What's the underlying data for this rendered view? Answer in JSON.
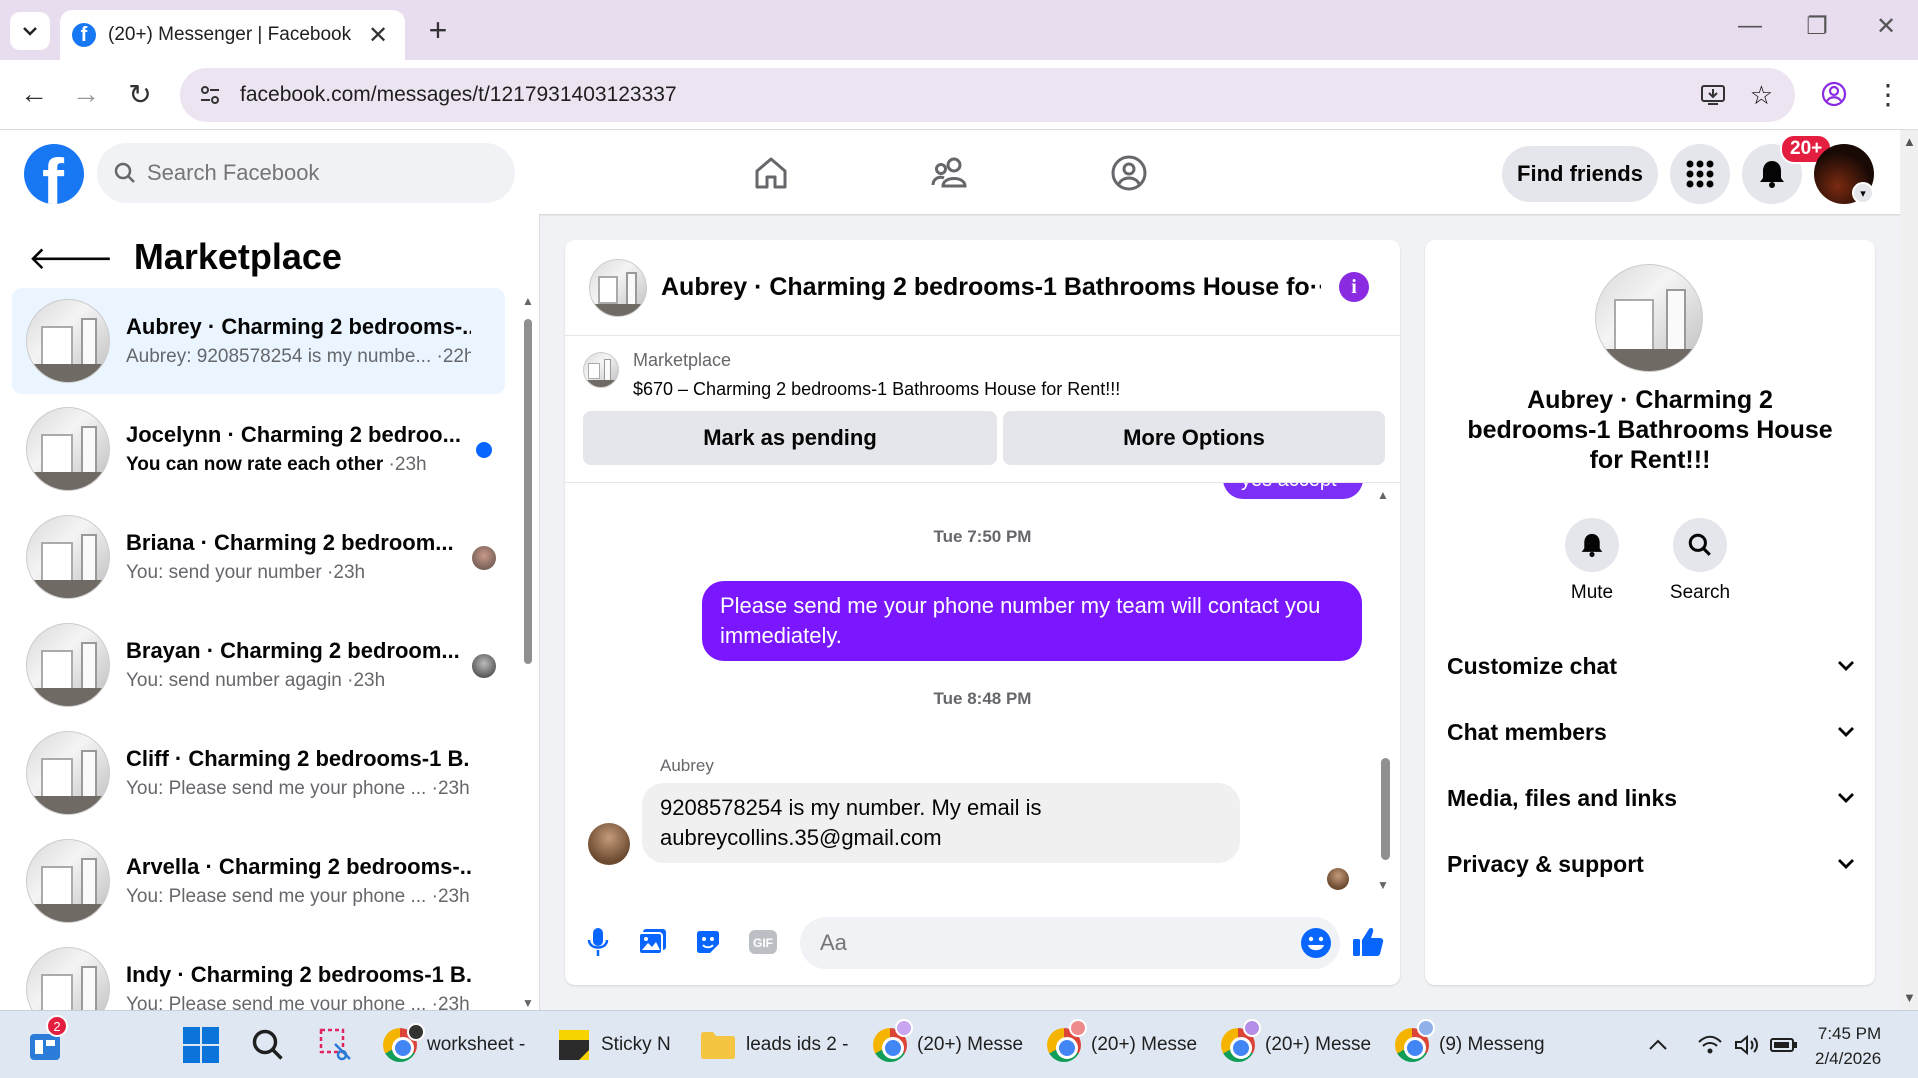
{
  "browser": {
    "tab_title": "(20+) Messenger | Facebook",
    "url": "facebook.com/messages/t/1217931403123337"
  },
  "fb_header": {
    "search_placeholder": "Search Facebook",
    "find_friends": "Find friends",
    "notification_count": "20+"
  },
  "sidebar": {
    "title": "Marketplace",
    "conversations": [
      {
        "title": "Aubrey · Charming 2 bedrooms-...",
        "preview": "Aubrey: 9208578254 is my numbe...",
        "time": "·22h",
        "active": true
      },
      {
        "title": "Jocelynn · Charming 2 bedroo...",
        "preview": "You can now rate each other",
        "time": "·23h",
        "unread": true
      },
      {
        "title": "Briana · Charming 2 bedroom...",
        "preview": "You: send your number",
        "time": "·23h"
      },
      {
        "title": "Brayan · Charming 2 bedroom...",
        "preview": "You: send number agagin",
        "time": "·23h"
      },
      {
        "title": "Cliff · Charming 2 bedrooms-1 B...",
        "preview": "You: Please send me your phone ...",
        "time": "·23h"
      },
      {
        "title": "Arvella · Charming 2 bedrooms-...",
        "preview": "You: Please send me your phone ...",
        "time": "·23h"
      },
      {
        "title": "Indy · Charming 2 bedrooms-1 B...",
        "preview": "You: Please send me your phone ...",
        "time": "·23h"
      }
    ]
  },
  "chat": {
    "title": "Aubrey · Charming 2 bedrooms-1 Bathrooms House fo···",
    "listing_label": "Marketplace",
    "listing_title": "$670 – Charming 2 bedrooms-1 Bathrooms House for Rent!!!",
    "mark_pending": "Mark as pending",
    "more_options": "More Options",
    "partial_message": "yes accept",
    "timestamp_1": "Tue 7:50 PM",
    "outgoing_message": "Please send me your phone number my team will contact you immediately.",
    "timestamp_2": "Tue 8:48 PM",
    "sender_name": "Aubrey",
    "incoming_message": "9208578254 is my number. My email is aubreycollins.35@gmail.com",
    "input_placeholder": "Aa"
  },
  "info_panel": {
    "name": "Aubrey · Charming 2 bedrooms-1 Bathrooms House for Rent!!!",
    "mute_label": "Mute",
    "search_label": "Search",
    "sections": [
      "Customize chat",
      "Chat members",
      "Media, files and links",
      "Privacy & support"
    ]
  },
  "taskbar": {
    "widgets_badge": "2",
    "apps": [
      "worksheet -",
      "Sticky N",
      "leads ids 2 -",
      "(20+) Messe",
      "(20+) Messe",
      "(20+) Messe",
      "(9) Messeng"
    ],
    "time": "7:45 PM",
    "date": "2/4/2026"
  },
  "colors": {
    "fb_blue": "#1877f2",
    "messenger_purple": "#7b17ff",
    "unread_dot": "#0866ff",
    "badge_red": "#e41e3f"
  }
}
